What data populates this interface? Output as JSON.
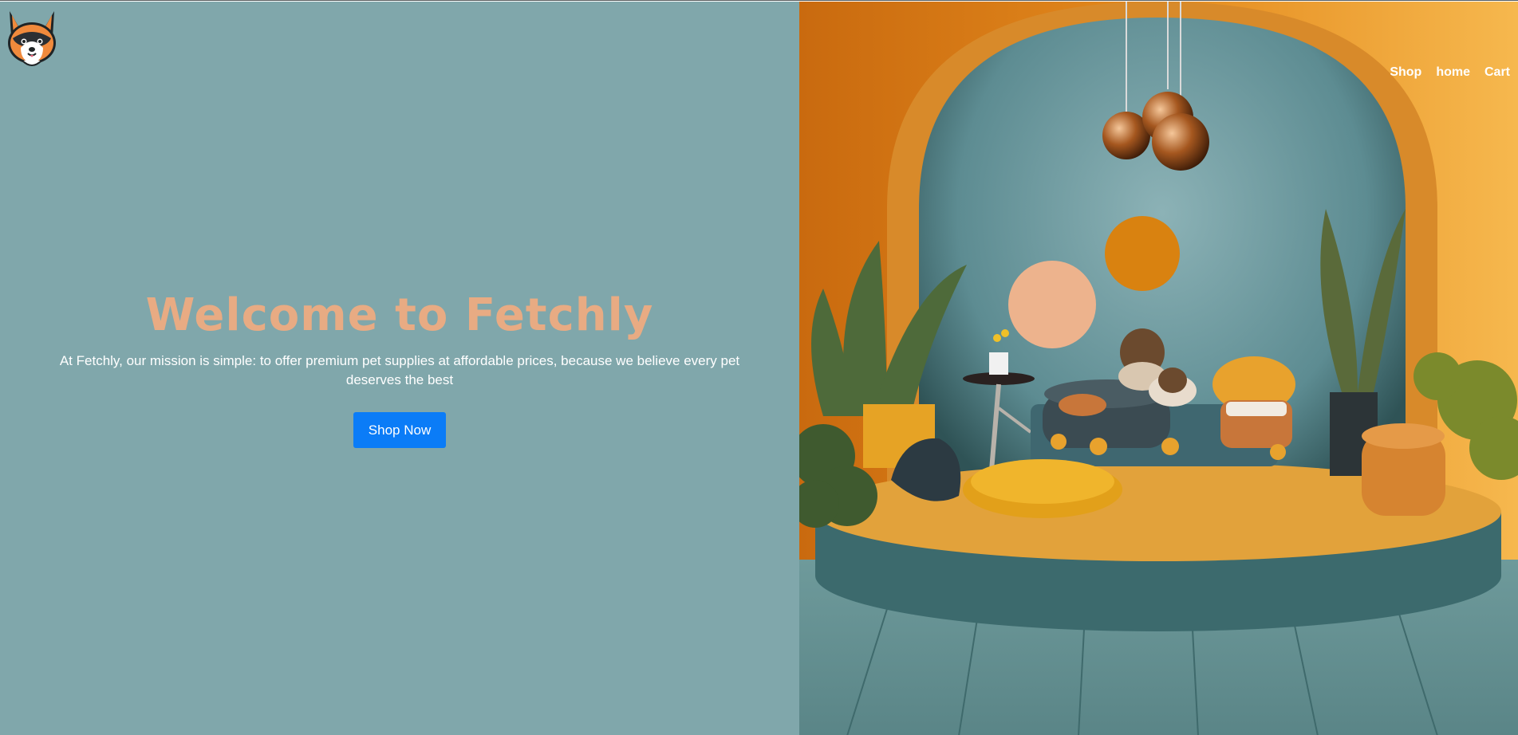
{
  "brand": {
    "logo_icon": "corgi-dog-logo-icon"
  },
  "nav": {
    "items": [
      {
        "label": "Shop"
      },
      {
        "label": "home"
      },
      {
        "label": "Cart"
      }
    ]
  },
  "hero": {
    "title": "Welcome to Fetchly",
    "text": "At Fetchly, our mission is simple: to offer premium pet supplies at affordable prices, because we believe every pet deserves the best",
    "cta_label": "Shop Now"
  },
  "colors": {
    "left_background": "#80a7ab",
    "title": "#e8ab83",
    "cta_background": "#0b7cf7",
    "accent_orange": "#e6951f",
    "accent_teal": "#6f9fa4"
  },
  "image": {
    "scene": "interior-pet-room-image"
  }
}
